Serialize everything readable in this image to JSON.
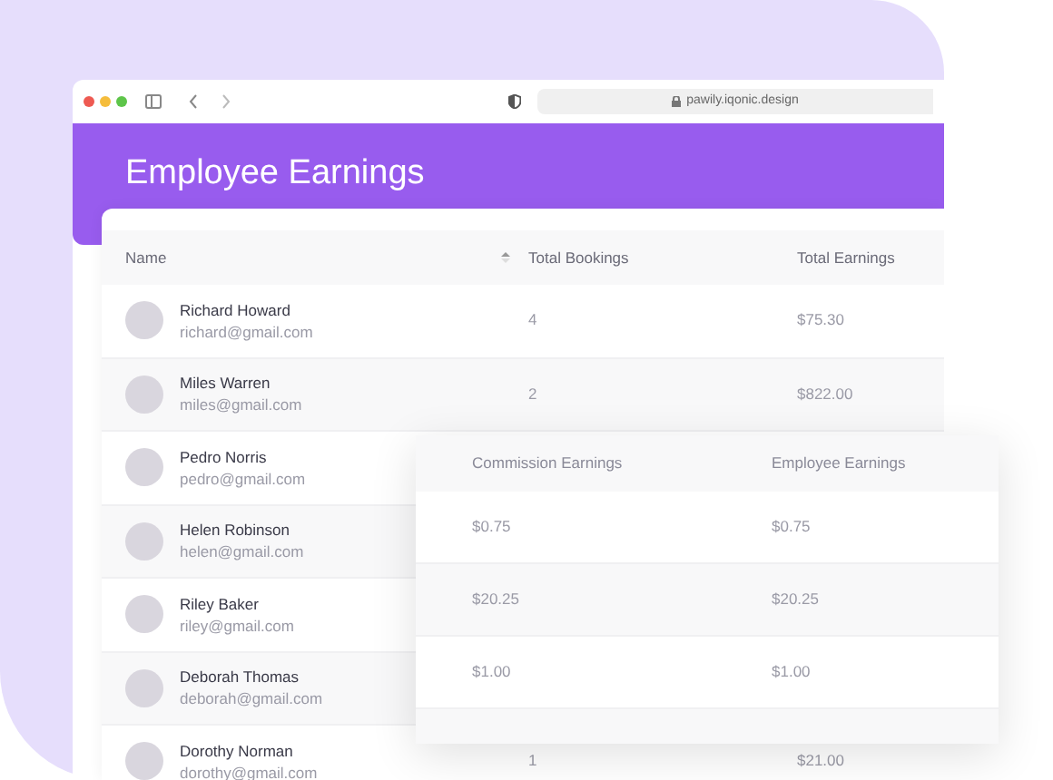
{
  "browser": {
    "url": "pawily.iqonic.design"
  },
  "page": {
    "title": "Employee Earnings"
  },
  "table": {
    "columns": [
      "Name",
      "Total Bookings",
      "Total Earnings"
    ],
    "rows": [
      {
        "name": "Richard Howard",
        "email": "richard@gmail.com",
        "bookings": "4",
        "earnings": "$75.30"
      },
      {
        "name": "Miles Warren",
        "email": "miles@gmail.com",
        "bookings": "2",
        "earnings": "$822.00"
      },
      {
        "name": "Pedro Norris",
        "email": "pedro@gmail.com"
      },
      {
        "name": "Helen Robinson",
        "email": "helen@gmail.com"
      },
      {
        "name": "Riley Baker",
        "email": "riley@gmail.com"
      },
      {
        "name": "Deborah Thomas",
        "email": "deborah@gmail.com"
      },
      {
        "name": "Dorothy Norman",
        "email": "dorothy@gmail.com",
        "bookings": "1",
        "earnings": "$21.00"
      }
    ]
  },
  "overlay_table": {
    "columns": [
      "Commission Earnings",
      "Employee Earnings"
    ],
    "rows": [
      [
        "$0.75",
        "$0.75"
      ],
      [
        "$20.25",
        "$20.25"
      ],
      [
        "$1.00",
        "$1.00"
      ],
      []
    ]
  }
}
